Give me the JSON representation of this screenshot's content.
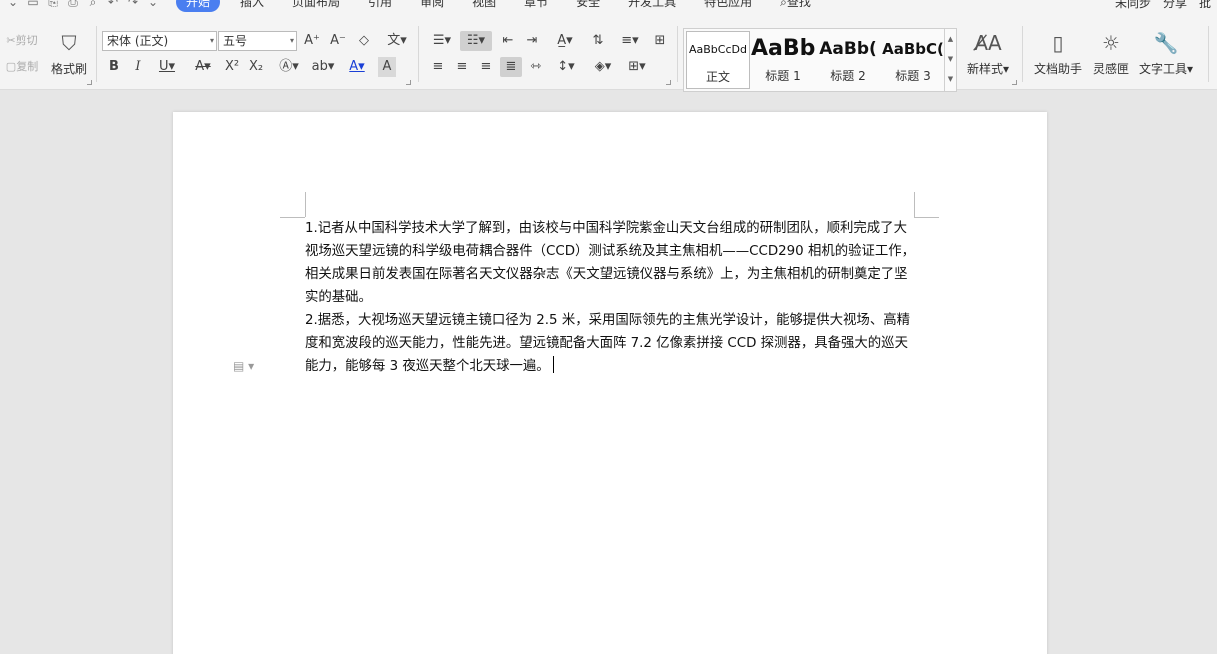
{
  "topbar": {
    "tabs": [
      "开始",
      "插入",
      "页面布局",
      "引用",
      "审阅",
      "视图",
      "章节",
      "安全",
      "开发工具",
      "特色应用"
    ],
    "search_label": "查找",
    "sync_label": "未同步",
    "share_label": "分享",
    "comment_label": "批"
  },
  "ribbon": {
    "clipboard": {
      "cut_label": "剪切",
      "copy_label": "复制",
      "format_painter_label": "格式刷"
    },
    "font": {
      "font_name": "宋体 (正文)",
      "font_size": "五号"
    },
    "styles": [
      {
        "sample": "AaBbCcDd",
        "name": "正文",
        "selected": true
      },
      {
        "sample": "AaBb",
        "name": "标题 1",
        "selected": false
      },
      {
        "sample": "AaBb(",
        "name": "标题 2",
        "selected": false
      },
      {
        "sample": "AaBbC(",
        "name": "标题 3",
        "selected": false
      }
    ],
    "new_style_label": "新样式",
    "tools": [
      {
        "label": "文档助手",
        "icon": "doc-assistant-icon"
      },
      {
        "label": "灵感匣",
        "icon": "lightbulb-icon"
      },
      {
        "label": "文字工具",
        "icon": "wrench-icon"
      }
    ]
  },
  "document": {
    "paragraphs": [
      "1.记者从中国科学技术大学了解到，由该校与中国科学院紫金山天文台组成的研制团队，顺利完成了大视场巡天望远镜的科学级电荷耦合器件（CCD）测试系统及其主焦相机——CCD290 相机的验证工作，相关成果日前发表国在际著名天文仪器杂志《天文望远镜仪器与系统》上，为主焦相机的研制奠定了坚实的基础。",
      "2.据悉，大视场巡天望远镜主镜口径为 2.5 米，采用国际领先的主焦光学设计，能够提供大视场、高精度和宽波段的巡天能力，性能先进。望远镜配备大面阵 7.2 亿像素拼接 CCD 探测器，具备强大的巡天能力，能够每 3 夜巡天整个北天球一遍。"
    ]
  }
}
